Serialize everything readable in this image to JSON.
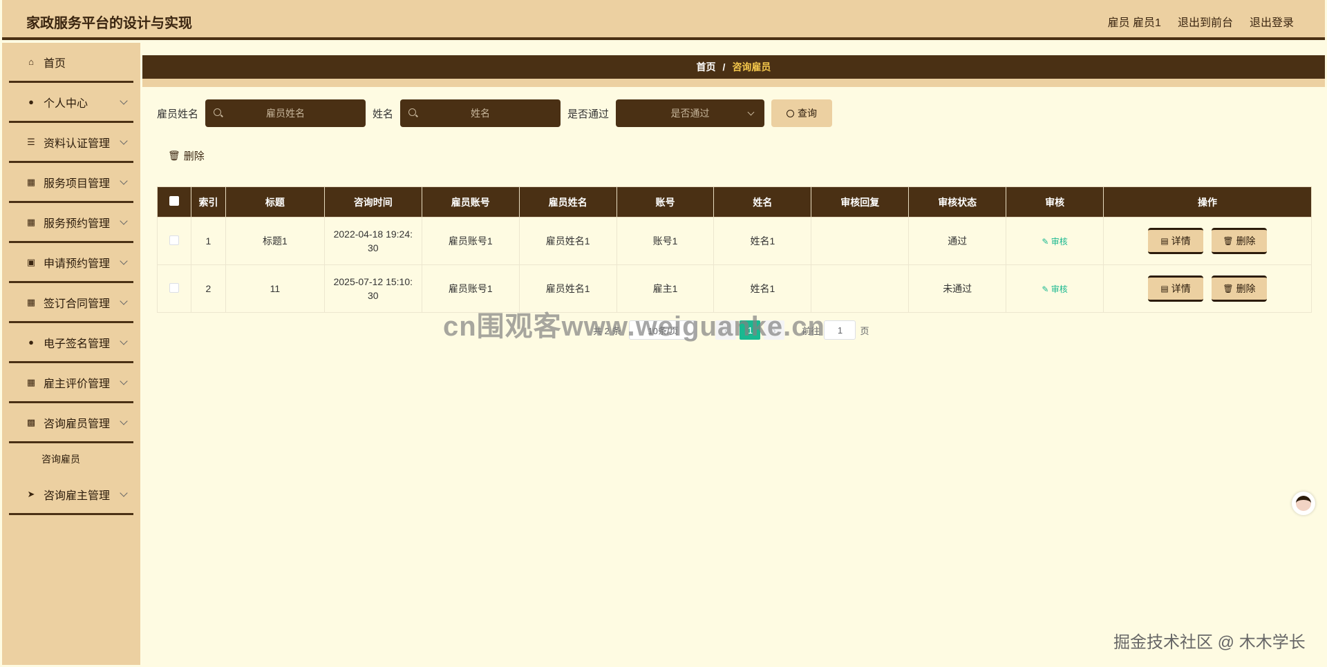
{
  "header": {
    "title": "家政服务平台的设计与实现",
    "user": "雇员 雇员1",
    "to_front": "退出到前台",
    "logout": "退出登录"
  },
  "sidebar": {
    "items": [
      {
        "label": "首页",
        "icon": "home-icon",
        "expandable": false
      },
      {
        "label": "个人中心",
        "icon": "user-icon",
        "expandable": true
      },
      {
        "label": "资料认证管理",
        "icon": "list-icon",
        "expandable": true
      },
      {
        "label": "服务项目管理",
        "icon": "grid-icon",
        "expandable": true
      },
      {
        "label": "服务预约管理",
        "icon": "grid-icon",
        "expandable": true
      },
      {
        "label": "申请预约管理",
        "icon": "chat-icon",
        "expandable": true
      },
      {
        "label": "签订合同管理",
        "icon": "grid-icon",
        "expandable": true
      },
      {
        "label": "电子签名管理",
        "icon": "user-icon",
        "expandable": true
      },
      {
        "label": "雇主评价管理",
        "icon": "grid-icon",
        "expandable": true
      },
      {
        "label": "咨询雇员管理",
        "icon": "monitor-icon",
        "expandable": true
      },
      {
        "label": "咨询雇主管理",
        "icon": "send-icon",
        "expandable": true
      }
    ],
    "submenu_label": "咨询雇员"
  },
  "breadcrumb": {
    "home": "首页",
    "sep": "/",
    "current": "咨询雇员"
  },
  "search": {
    "emp_name_label": "雇员姓名",
    "emp_name_placeholder": "雇员姓名",
    "name_label": "姓名",
    "name_placeholder": "姓名",
    "pass_label": "是否通过",
    "pass_placeholder": "是否通过",
    "query_label": "查询"
  },
  "toolbar": {
    "delete_label": "删除"
  },
  "table": {
    "headers": [
      "索引",
      "标题",
      "咨询时间",
      "雇员账号",
      "雇员姓名",
      "账号",
      "姓名",
      "审核回复",
      "审核状态",
      "审核",
      "操作"
    ],
    "rows": [
      {
        "index": "1",
        "title": "标题1",
        "time": "2022-04-18 19:24:30",
        "emp_account": "雇员账号1",
        "emp_name": "雇员姓名1",
        "account": "账号1",
        "name": "姓名1",
        "reply": "",
        "status": "通过",
        "audit": "审核"
      },
      {
        "index": "2",
        "title": "11",
        "time": "2025-07-12 15:10:30",
        "emp_account": "雇员账号1",
        "emp_name": "雇员姓名1",
        "account": "雇主1",
        "name": "姓名1",
        "reply": "",
        "status": "未通过",
        "audit": "审核"
      }
    ],
    "detail_label": "详情",
    "delete_label": "删除"
  },
  "pagination": {
    "total": "共 2 条",
    "page_size": "10条/页",
    "current_page": "1",
    "goto_label": "前往",
    "goto_value": "1",
    "page_unit": "页"
  },
  "watermarks": {
    "center": "cn围观客www.weiguanke.cn",
    "corner": "掘金技术社区 @ 木木学长"
  },
  "colors": {
    "header_bg": "#ecd0a1",
    "dark_brown": "#4a3014",
    "page_bg": "#fefbe2",
    "accent_green": "#19b890",
    "crumb_current": "#f5c84c"
  }
}
